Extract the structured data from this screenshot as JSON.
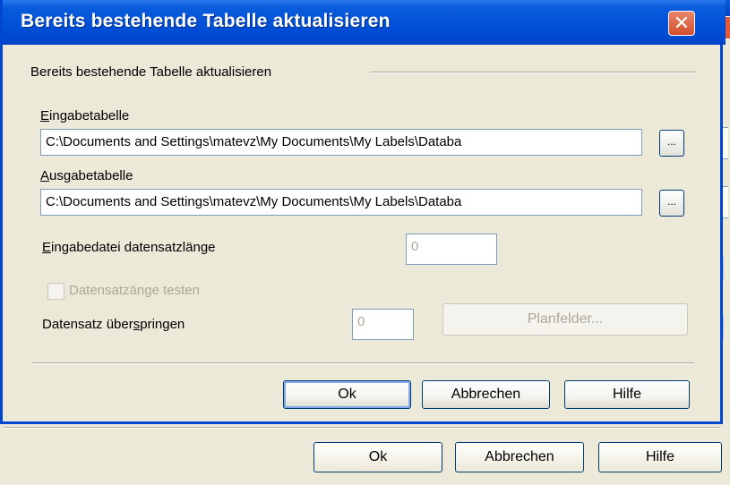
{
  "background_dialog": {
    "close_glyph": "✕",
    "buttons": {
      "ok": "Ok",
      "cancel": "Abbrechen",
      "help": "Hilfe"
    }
  },
  "dialog": {
    "title": "Bereits bestehende Tabelle aktualisieren",
    "close_glyph": "✕",
    "group_label": "Bereits bestehende Tabelle aktualisieren",
    "input_table": {
      "label_mnemonic": "E",
      "label_rest": "ingabetabelle",
      "value": "C:\\Documents and Settings\\matevz\\My Documents\\My Labels\\Databa",
      "browse_label": "..."
    },
    "output_table": {
      "label_mnemonic": "A",
      "label_rest": "usgabetabelle",
      "value": "C:\\Documents and Settings\\matevz\\My Documents\\My Labels\\Databa",
      "browse_label": "..."
    },
    "record_length": {
      "label_mnemonic": "E",
      "label_rest": "ingabedatei datensatzlänge",
      "value": "0"
    },
    "test_record_length": {
      "label": "Datensatzänge testen",
      "checked": false
    },
    "skip_records": {
      "label_pre": "Datensatz über",
      "label_mnemonic": "s",
      "label_post": "pringen",
      "value": "0"
    },
    "field_layout_button": "Planfelder...",
    "buttons": {
      "ok": "Ok",
      "cancel": "Abbrechen",
      "help": "Hilfe"
    }
  },
  "colors": {
    "titlebar": "#0050d8",
    "window_bg": "#ece9d8",
    "close_red": "#d24e2c",
    "disabled_text": "#aca899"
  }
}
